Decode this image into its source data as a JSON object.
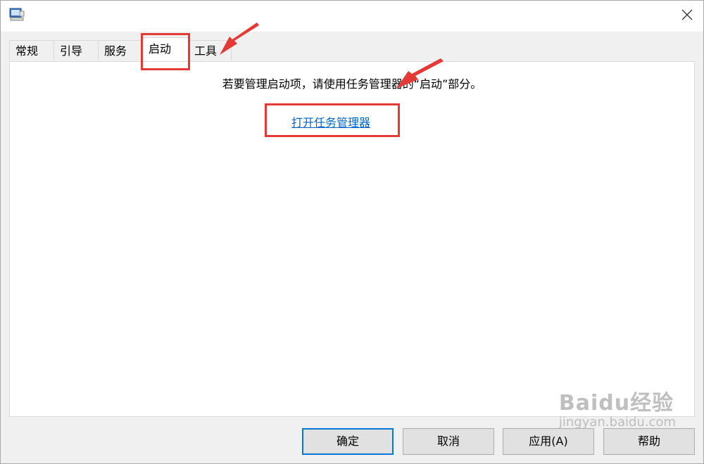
{
  "window": {
    "title": "",
    "icon": "system-configuration-icon",
    "close_icon": "close-icon"
  },
  "tabs": [
    {
      "label": "常规",
      "active": false
    },
    {
      "label": "引导",
      "active": false
    },
    {
      "label": "服务",
      "active": false
    },
    {
      "label": "启动",
      "active": true
    },
    {
      "label": "工具",
      "active": false
    }
  ],
  "startup": {
    "message": "若要管理启动项，请使用任务管理器的“启动”部分。",
    "link_label": "打开任务管理器"
  },
  "buttons": {
    "ok": "确定",
    "cancel": "取消",
    "apply": "应用(A)",
    "help": "帮助"
  },
  "annotations": {
    "highlight_color": "#e53935"
  },
  "watermark": {
    "brand": "Baidu经验",
    "url": "jingyan.baidu.com"
  }
}
